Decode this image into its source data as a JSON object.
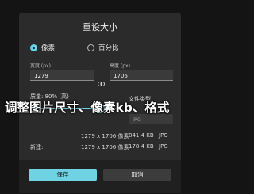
{
  "dialog": {
    "title": "重设大小",
    "mode_options": [
      {
        "label": "像素",
        "selected": true
      },
      {
        "label": "百分比",
        "selected": false
      }
    ],
    "width_label": "宽度 (px)",
    "width_value": "1279",
    "height_label": "高度 (px)",
    "height_value": "1706",
    "quality_label": "质量: 80% (高)",
    "quality_percent": 80,
    "file_type_label": "文件类型",
    "file_type_value": "JPG",
    "current": {
      "dims": "1279 x 1706 像素",
      "size": "841.4 KB",
      "type": "JPG"
    },
    "new": {
      "label": "新建:",
      "dims": "1279 x 1706 像素",
      "size": "178.4 KB",
      "type": "JPG"
    },
    "save_label": "保存",
    "cancel_label": "取消"
  },
  "overlay_text": "调整图片尺寸、像素kb、格式",
  "colors": {
    "accent": "#66d4e6",
    "dialog_bg": "#2b2b2b",
    "page_bg": "#141414"
  },
  "icons": {
    "link": "link-icon"
  }
}
